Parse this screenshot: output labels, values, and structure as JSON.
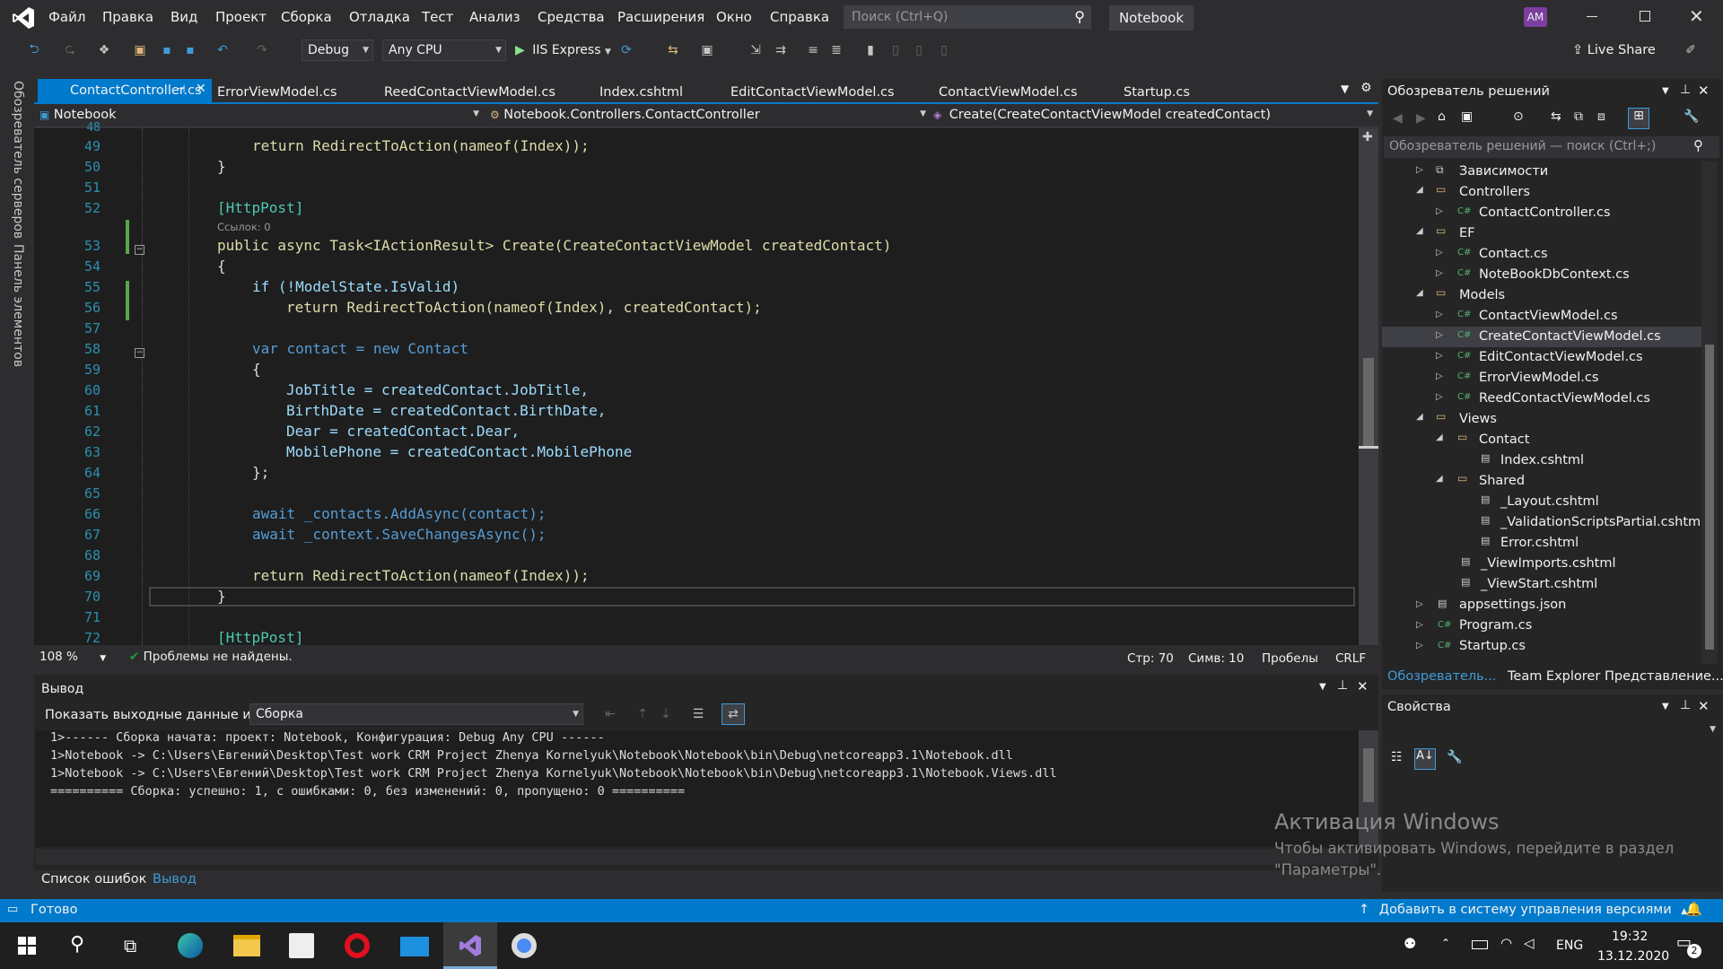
{
  "title_bar": {
    "project_name": "Notebook",
    "search_placeholder": "Поиск (Ctrl+Q)",
    "user_initials": "AM"
  },
  "menu": [
    "Файл",
    "Правка",
    "Вид",
    "Проект",
    "Сборка",
    "Отладка",
    "Тест",
    "Анализ",
    "Средства",
    "Расширения",
    "Окно",
    "Справка"
  ],
  "toolbar": {
    "config": "Debug",
    "platform": "Any CPU",
    "run_target": "IIS Express",
    "live_share": "Live Share"
  },
  "tabs": [
    "ContactController.cs",
    "ErrorViewModel.cs",
    "ReedContactViewModel.cs",
    "Index.cshtml",
    "EditContactViewModel.cs",
    "ContactViewModel.cs",
    "Startup.cs"
  ],
  "nav_bar": {
    "project": "Notebook",
    "class": "Notebook.Controllers.ContactController",
    "member": "Create(CreateContactViewModel createdContact)"
  },
  "side_tabs": [
    "Обозреватель серверов",
    "Панель элементов"
  ],
  "editor": {
    "codelens": "Ссылок: 0",
    "line_numbers": [
      "48",
      "49",
      "50",
      "51",
      "52",
      "53",
      "54",
      "55",
      "56",
      "57",
      "58",
      "59",
      "60",
      "61",
      "62",
      "63",
      "64",
      "65",
      "66",
      "67",
      "68",
      "69",
      "70",
      "71",
      "72"
    ],
    "code": {
      "l49": "return RedirectToAction(nameof(Index));",
      "l50": "}",
      "l52": "[HttpPost]",
      "l53": "public async Task<IActionResult> Create(CreateContactViewModel createdContact)",
      "l54": "{",
      "l55": "if (!ModelState.IsValid)",
      "l56": "return RedirectToAction(nameof(Index), createdContact);",
      "l58": "var contact = new Contact",
      "l59": "{",
      "l60": "JobTitle = createdContact.JobTitle,",
      "l61": "BirthDate = createdContact.BirthDate,",
      "l62": "Dear = createdContact.Dear,",
      "l63": "MobilePhone = createdContact.MobilePhone",
      "l64": "};",
      "l66": "await _contacts.AddAsync(contact);",
      "l67": "await _context.SaveChangesAsync();",
      "l69": "return RedirectToAction(nameof(Index));",
      "l70": "}",
      "l72": "[HttpPost]"
    }
  },
  "editor_status": {
    "zoom": "108 %",
    "issues": "Проблемы не найдены.",
    "line": "Стр: 70",
    "col": "Симв: 10",
    "spaces": "Пробелы",
    "eol": "CRLF"
  },
  "solution_explorer": {
    "title": "Обозреватель решений",
    "search_placeholder": "Обозреватель решений — поиск (Ctrl+;)",
    "items": [
      "Зависимости",
      "Controllers",
      "ContactController.cs",
      "EF",
      "Contact.cs",
      "NoteBookDbContext.cs",
      "Models",
      "ContactViewModel.cs",
      "CreateContactViewModel.cs",
      "EditContactViewModel.cs",
      "ErrorViewModel.cs",
      "ReedContactViewModel.cs",
      "Views",
      "Contact",
      "Index.cshtml",
      "Shared",
      "_Layout.cshtml",
      "_ValidationScriptsPartial.cshtml",
      "Error.cshtml",
      "_ViewImports.cshtml",
      "_ViewStart.cshtml",
      "appsettings.json",
      "Program.cs",
      "Startup.cs"
    ],
    "bottom_tabs": [
      "Обозреватель...",
      "Team Explorer",
      "Представление..."
    ]
  },
  "properties": {
    "title": "Свойства"
  },
  "output": {
    "title": "Вывод",
    "show_label": "Показать выходные данные из:",
    "source": "Сборка",
    "lines": [
      "1>------ Сборка начата: проект: Notebook, Конфигурация: Debug Any CPU ------",
      "1>Notebook -> C:\\Users\\Евгений\\Desktop\\Test work CRM Project Zhenya Kornelyuk\\Notebook\\Notebook\\bin\\Debug\\netcoreapp3.1\\Notebook.dll",
      "1>Notebook -> C:\\Users\\Евгений\\Desktop\\Test work CRM Project Zhenya Kornelyuk\\Notebook\\Notebook\\bin\\Debug\\netcoreapp3.1\\Notebook.Views.dll",
      "========== Сборка: успешно: 1, с ошибками: 0, без изменений: 0, пропущено: 0 =========="
    ],
    "bottom_tabs": [
      "Список ошибок",
      "Вывод"
    ]
  },
  "watermark": {
    "title": "Активация Windows",
    "line1": "Чтобы активировать Windows, перейдите в раздел",
    "line2": "\"Параметры\"."
  },
  "status_bar": {
    "ready": "Готово",
    "source_control": "Добавить в систему управления версиями"
  },
  "taskbar": {
    "time": "19:32",
    "date": "13.12.2020",
    "lang": "ENG",
    "notif_count": "2"
  }
}
